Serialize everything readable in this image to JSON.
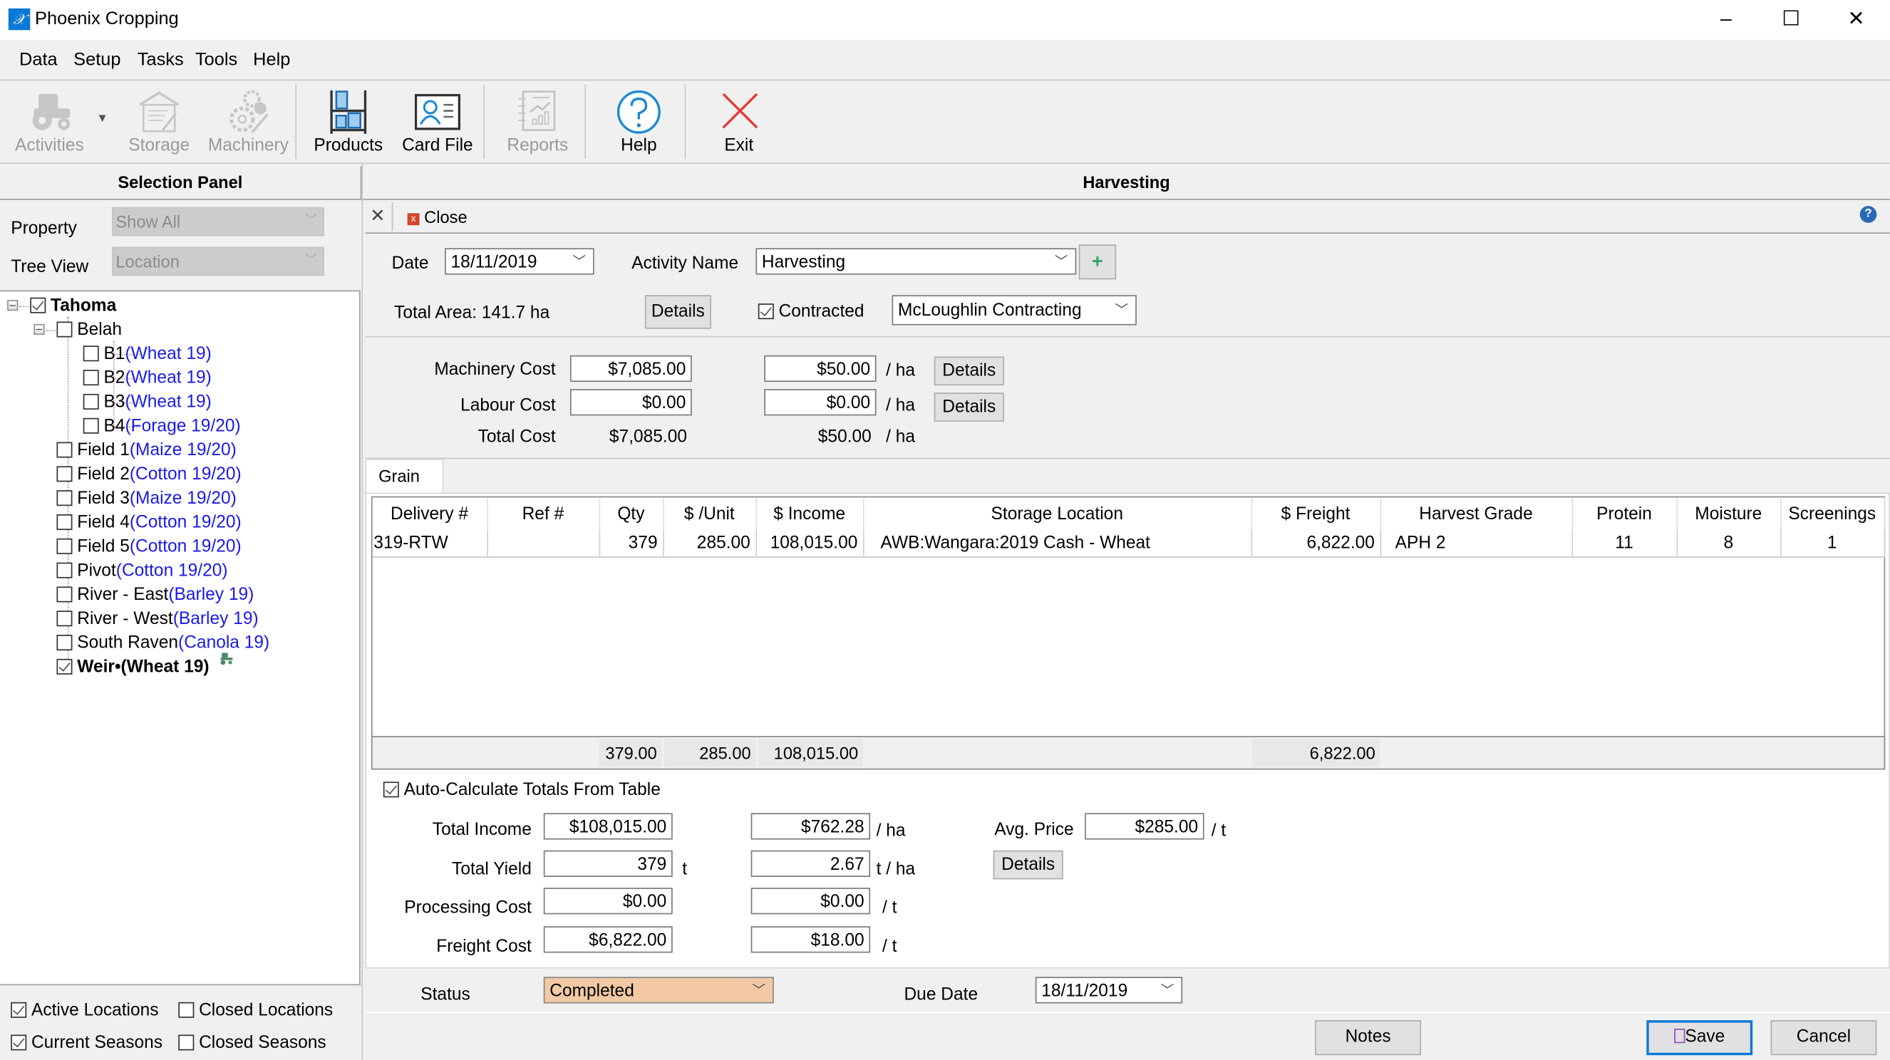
{
  "window": {
    "title": "Phoenix Cropping",
    "app_icon": "phoenix-logo-icon",
    "controls": {
      "minimize": "–",
      "maximize": "☐",
      "close": "✕"
    }
  },
  "menu": [
    "Data",
    "Setup",
    "Tasks",
    "Tools",
    "Help"
  ],
  "toolbar": [
    {
      "label": "Activities",
      "icon": "tractor-icon",
      "enabled": false,
      "has_dropdown": true
    },
    {
      "label": "Storage",
      "icon": "storage-shed-icon",
      "enabled": false
    },
    {
      "label": "Machinery",
      "icon": "gears-icon",
      "enabled": false
    },
    {
      "label": "Products",
      "icon": "shelf-icon",
      "enabled": true
    },
    {
      "label": "Card File",
      "icon": "contact-card-icon",
      "enabled": true
    },
    {
      "label": "Reports",
      "icon": "report-icon",
      "enabled": false
    },
    {
      "label": "Help",
      "icon": "help-icon",
      "enabled": true
    },
    {
      "label": "Exit",
      "icon": "exit-icon",
      "enabled": true
    }
  ],
  "selection_panel": {
    "title": "Selection Panel",
    "property_label": "Property",
    "property_value": "Show All",
    "tree_view_label": "Tree View",
    "tree_view_value": "Location",
    "tree": {
      "root": {
        "name": "Tahoma",
        "checked": true
      },
      "group": {
        "name": "Belah",
        "checked": false
      },
      "group_children": [
        {
          "name": "B1",
          "crop": "(Wheat 19)",
          "checked": false
        },
        {
          "name": "B2",
          "crop": "(Wheat 19)",
          "checked": false
        },
        {
          "name": "B3",
          "crop": "(Wheat 19)",
          "checked": false
        },
        {
          "name": "B4",
          "crop": "(Forage 19/20)",
          "checked": false
        }
      ],
      "items": [
        {
          "name": "Field 1",
          "crop": "(Maize 19/20)",
          "checked": false
        },
        {
          "name": "Field 2",
          "crop": "(Cotton 19/20)",
          "checked": false
        },
        {
          "name": "Field 3",
          "crop": "(Maize 19/20)",
          "checked": false
        },
        {
          "name": "Field 4",
          "crop": "(Cotton 19/20)",
          "checked": false
        },
        {
          "name": "Field 5",
          "crop": "(Cotton 19/20)",
          "checked": false
        },
        {
          "name": "Pivot",
          "crop": "(Cotton 19/20)",
          "checked": false
        },
        {
          "name": "River - East",
          "crop": "(Barley 19)",
          "checked": false
        },
        {
          "name": "River - West",
          "crop": "(Barley 19)",
          "checked": false
        },
        {
          "name": "South Raven",
          "crop": "(Canola 19)",
          "checked": false
        }
      ],
      "selected_item": {
        "label": "Weir•(Wheat 19)",
        "checked": true,
        "badge_icon": "tractor-icon"
      }
    },
    "filters": {
      "active_locations": {
        "label": "Active Locations",
        "checked": true
      },
      "closed_locations": {
        "label": "Closed Locations",
        "checked": false
      },
      "current_seasons": {
        "label": "Current Seasons",
        "checked": true
      },
      "closed_seasons": {
        "label": "Closed Seasons",
        "checked": false
      }
    }
  },
  "harvesting": {
    "title": "Harvesting",
    "close_x": "✕",
    "close_label": "Close",
    "help_icon": "?",
    "date_label": "Date",
    "date_value": "18/11/2019",
    "activity_name_label": "Activity Name",
    "activity_name_value": "Harvesting",
    "add_button": "+",
    "total_area": "Total Area: 141.7 ha",
    "details_label": "Details",
    "contracted_label": "Contracted",
    "contracted_checked": true,
    "contractor_value": "McLoughlin Contracting",
    "costs": {
      "machinery_label": "Machinery Cost",
      "machinery_total": "$7,085.00",
      "machinery_per_ha": "$50.00",
      "labour_label": "Labour Cost",
      "labour_total": "$0.00",
      "labour_per_ha": "$0.00",
      "total_label": "Total Cost",
      "total_value": "$7,085.00",
      "total_per_ha": "$50.00",
      "per_ha_unit": "/ ha"
    },
    "tab": "Grain",
    "grid": {
      "columns": [
        "Delivery #",
        "Ref #",
        "Qty",
        "$ /Unit",
        "$ Income",
        "Storage Location",
        "$ Freight",
        "Harvest Grade",
        "Protein",
        "Moisture",
        "Screenings"
      ],
      "rows": [
        [
          "319-RTW",
          "",
          "379",
          "285.00",
          "108,015.00",
          "AWB:Wangara:2019 Cash - Wheat",
          "6,822.00",
          "APH 2",
          "11",
          "8",
          "1"
        ]
      ],
      "totals": {
        "qty": "379.00",
        "unit": "285.00",
        "income": "108,015.00",
        "freight": "6,822.00"
      }
    },
    "auto_calc": {
      "label": "Auto-Calculate Totals From Table",
      "checked": true
    },
    "summary": {
      "total_income_label": "Total Income",
      "total_income": "$108,015.00",
      "income_per_ha": "$762.28",
      "income_unit": "/ ha",
      "avg_price_label": "Avg. Price",
      "avg_price": "$285.00",
      "avg_price_unit": "/ t",
      "total_yield_label": "Total Yield",
      "total_yield": "379",
      "yield_unit": "t",
      "yield_per_ha": "2.67",
      "yield_per_ha_unit": "t / ha",
      "processing_label": "Processing Cost",
      "processing_total": "$0.00",
      "processing_per_t": "$0.00",
      "freight_label": "Freight Cost",
      "freight_total": "$6,822.00",
      "freight_per_t": "$18.00",
      "per_t_unit": "/ t"
    },
    "status_label": "Status",
    "status_value": "Completed",
    "status_color": "#f2c9a4",
    "due_date_label": "Due Date",
    "due_date_value": "18/11/2019",
    "notes_label": "Notes",
    "save_label": "Save",
    "cancel_label": "Cancel"
  }
}
